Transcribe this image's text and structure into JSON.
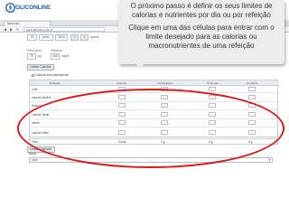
{
  "brand": {
    "logo_text": "GLICONLINE",
    "accent": "#1e5fa3",
    "highlight": "#e01616"
  },
  "browser": {
    "tab_label": "GlicOnline",
    "url": "www.gliconline.com.br",
    "back_icon": "arrow-left-icon",
    "forward_icon": "arrow-right-icon"
  },
  "date_selector": {
    "day": "15",
    "month": "julho",
    "year": "2015",
    "prev_label": "<",
    "next_label": ">",
    "weekday": "quarta"
  },
  "weight": {
    "label_left": "Peso atual",
    "label_right": "Glicemia",
    "value_left": "70",
    "value_right": "100",
    "unit_left": "kg",
    "unit_right": "mg/dl"
  },
  "buttons": {
    "edit_limits": "Limitar Calorias",
    "save": "Limitar Carboidr."
  },
  "panel": {
    "check_label": "Calcular Automaticamente",
    "headers": [
      "Refeição",
      "Calorias",
      "Carboidratos",
      "Proteínas",
      "Gorduras"
    ],
    "rows": [
      "Café",
      "Lanche Manhã",
      "Almoço",
      "Lanche Tarde",
      "Jantar",
      "Lanche Noite"
    ],
    "total_label": "Total",
    "total_values": [
      "0 kcal",
      "0 g",
      "0 g",
      "0 g"
    ]
  },
  "dieta": {
    "label": "Dieta",
    "selected": "Livre"
  },
  "callout": {
    "paragraph1": "O próximo passo é definir os seus limites de calorias e nutrientes por dia ou por refeição",
    "paragraph2": "Clique em uma das células para entrar com o limite desejado para as calorias ou macronutrientes de uma refeição"
  }
}
